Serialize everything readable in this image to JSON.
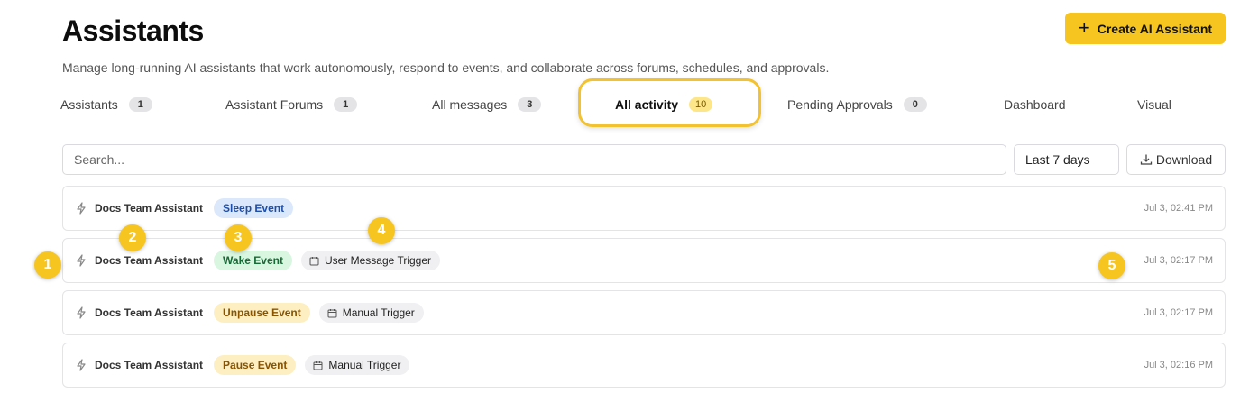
{
  "header": {
    "title": "Assistants",
    "subtitle": "Manage long-running AI assistants that work autonomously, respond to events, and collaborate across forums, schedules, and approvals.",
    "create_button_label": "Create AI Assistant",
    "create_button_icon": "plus-icon"
  },
  "tabs": [
    {
      "label": "Assistants",
      "count": "1"
    },
    {
      "label": "Assistant Forums",
      "count": "1"
    },
    {
      "label": "All messages",
      "count": "3"
    },
    {
      "label": "All activity",
      "count": "10",
      "active": true
    },
    {
      "label": "Pending Approvals",
      "count": "0"
    },
    {
      "label": "Dashboard"
    },
    {
      "label": "Visual"
    }
  ],
  "toolbar": {
    "search_placeholder": "Search...",
    "range_value": "Last 7 days",
    "download_label": "Download",
    "download_icon": "download-icon"
  },
  "activity": [
    {
      "icon": "bolt-icon",
      "assistant": "Docs Team Assistant",
      "event": "Sleep Event",
      "event_color": "blue",
      "trigger": "",
      "time": "Jul 3, 02:41 PM"
    },
    {
      "icon": "bolt-icon",
      "assistant": "Docs Team Assistant",
      "event": "Wake Event",
      "event_color": "green",
      "trigger": "User Message Trigger",
      "time": "Jul 3, 02:17 PM"
    },
    {
      "icon": "bolt-icon",
      "assistant": "Docs Team Assistant",
      "event": "Unpause Event",
      "event_color": "amber",
      "trigger": "Manual Trigger",
      "time": "Jul 3, 02:17 PM"
    },
    {
      "icon": "bolt-icon",
      "assistant": "Docs Team Assistant",
      "event": "Pause Event",
      "event_color": "amber",
      "trigger": "Manual Trigger",
      "time": "Jul 3, 02:16 PM"
    }
  ],
  "markers": [
    "1",
    "2",
    "3",
    "4",
    "5"
  ],
  "colors": {
    "accent": "#f7c51f",
    "highlight_border": "#f2c230",
    "tab_count_active_bg": "#fde68a"
  }
}
